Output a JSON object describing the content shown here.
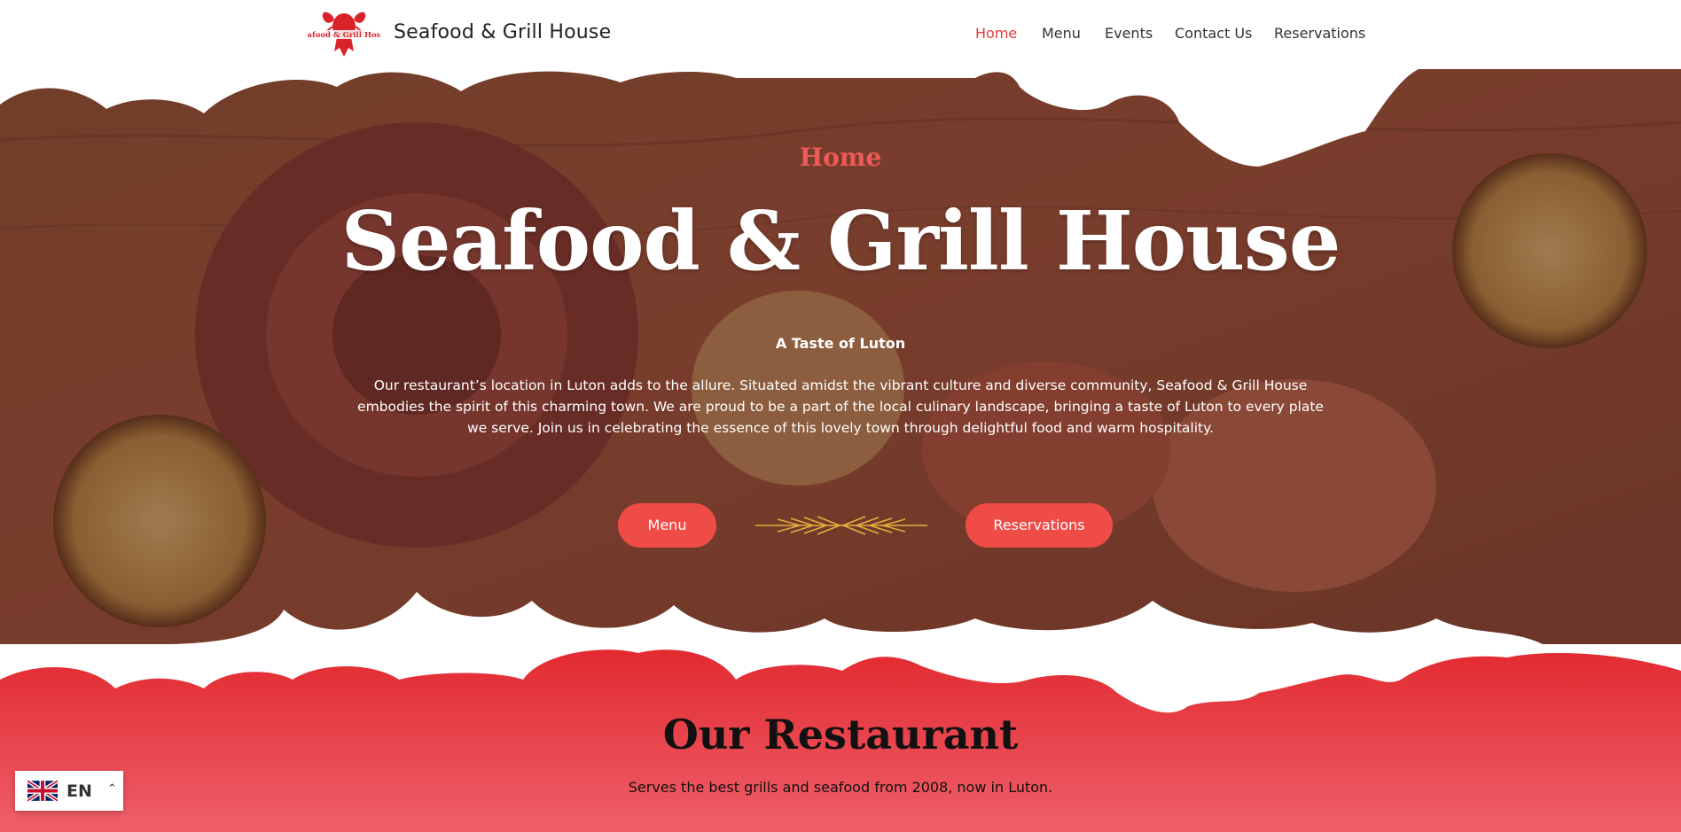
{
  "header": {
    "brand": "Seafood & Grill House",
    "logo_text": "Seafood & Grill House",
    "nav": [
      {
        "label": "Home",
        "active": true
      },
      {
        "label": "Menu",
        "active": false
      },
      {
        "label": "Events",
        "active": false
      },
      {
        "label": "Contact Us",
        "active": false
      },
      {
        "label": "Reservations",
        "active": false
      }
    ]
  },
  "hero": {
    "kicker": "Home",
    "title": "Seafood & Grill House",
    "subtitle": "A Taste of Luton",
    "body": "Our restaurant’s location in Luton adds to the allure. Situated amidst the vibrant culture and diverse community, Seafood & Grill House embodies the spirit of this charming town. We are proud to be a part of the local culinary landscape, bringing a taste of Luton to every plate we serve. Join us in celebrating the essence of this lovely town through delightful food and warm hospitality.",
    "buttons": {
      "menu": "Menu",
      "reservations": "Reservations"
    }
  },
  "restaurant": {
    "title": "Our Restaurant",
    "subtitle": "Serves the best grills and seafood from 2008, now in Luton."
  },
  "language": {
    "code": "EN",
    "flag": "uk-flag-icon",
    "caret": "chevron-up-icon"
  },
  "colors": {
    "accent": "#ef4b47",
    "nav_active": "#e03a34",
    "kicker": "#ef5a55",
    "section_red": "#e8303a"
  }
}
